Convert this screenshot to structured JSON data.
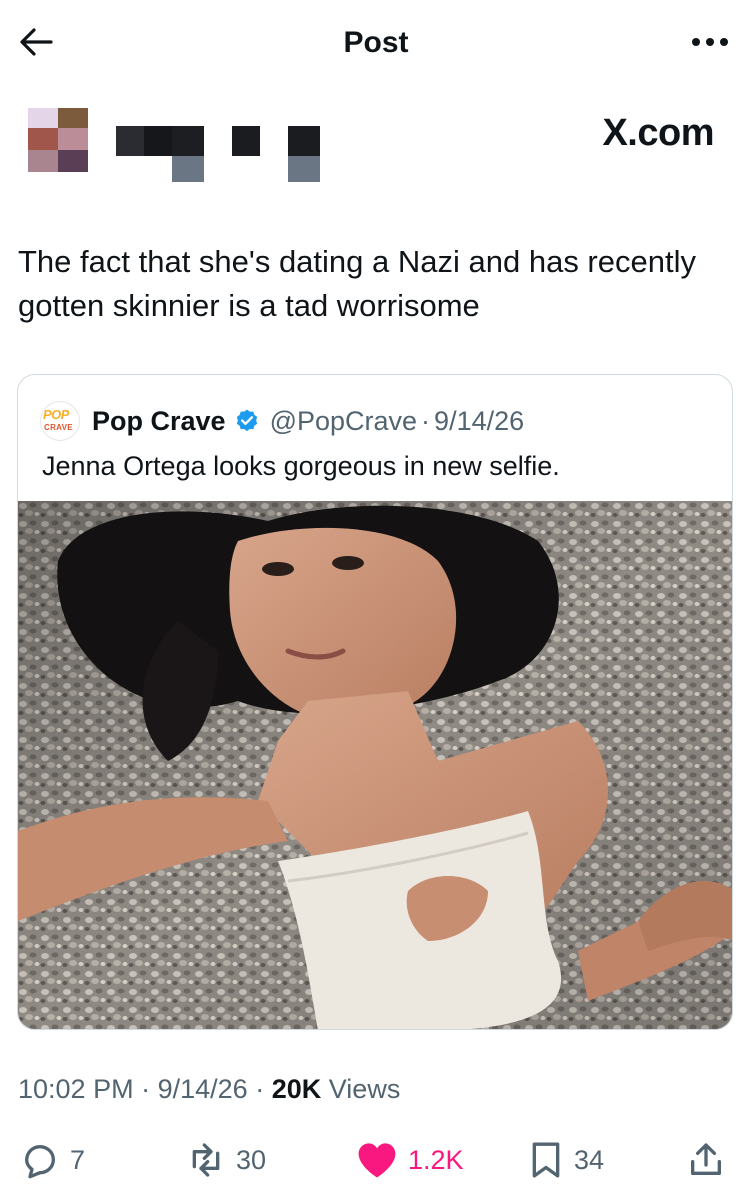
{
  "header": {
    "title": "Post",
    "back_icon": "arrow-left-icon",
    "more_icon": "ellipsis-icon"
  },
  "watermark": {
    "brand": "X.com"
  },
  "post": {
    "text": "The fact that she's dating a Nazi and has recently gotten skinnier is a tad worrisome",
    "author_censored": true,
    "time": "10:02 PM",
    "date": "9/14/26",
    "views_count": "20K",
    "views_label": "Views",
    "sep": "·"
  },
  "quote": {
    "name": "Pop Crave",
    "verified": true,
    "handle": "@PopCrave",
    "date": "9/14/26",
    "sep": "·",
    "text": "Jenna Ortega looks gorgeous in new selfie.",
    "avatar_text_top": "POP",
    "avatar_text_bottom": "CRAVE",
    "has_photo": true
  },
  "actions": {
    "replies": "7",
    "reposts": "30",
    "likes": "1.2K",
    "bookmarks": "34",
    "icons": [
      "reply-icon",
      "repost-icon",
      "heart-icon",
      "bookmark-icon",
      "share-icon"
    ]
  },
  "colors": {
    "text": "#0f1419",
    "secondary": "#536471",
    "like": "#f91880",
    "verified": "#1d9bf0",
    "border": "#cfd9de"
  }
}
